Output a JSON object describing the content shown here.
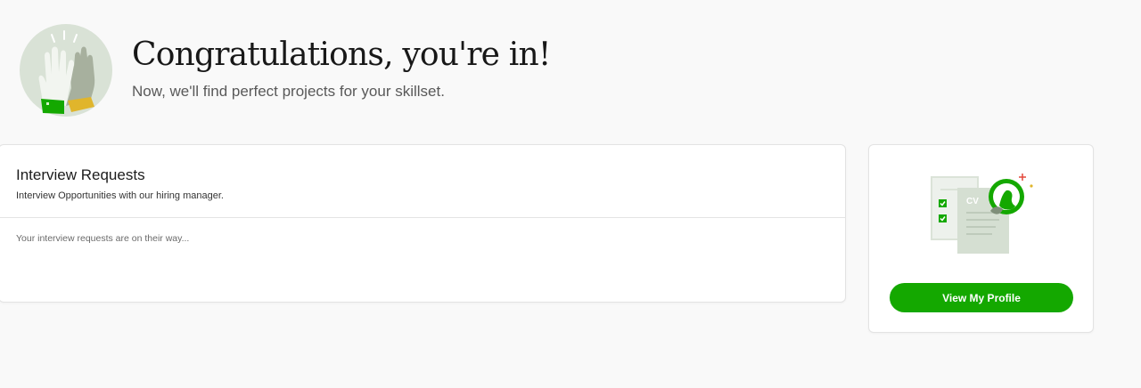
{
  "hero": {
    "title": "Congratulations, you're in!",
    "subtitle": "Now, we'll find perfect projects for your skillset."
  },
  "interview_requests": {
    "title": "Interview Requests",
    "subtitle": "Interview Opportunities with our hiring manager.",
    "empty_message": "Your interview requests are on their way..."
  },
  "profile_card": {
    "cv_label": "CV",
    "button_label": "View My Profile"
  },
  "colors": {
    "accent_green": "#14a800",
    "light_green": "#d6e2d3",
    "background": "#f9f9f9"
  }
}
